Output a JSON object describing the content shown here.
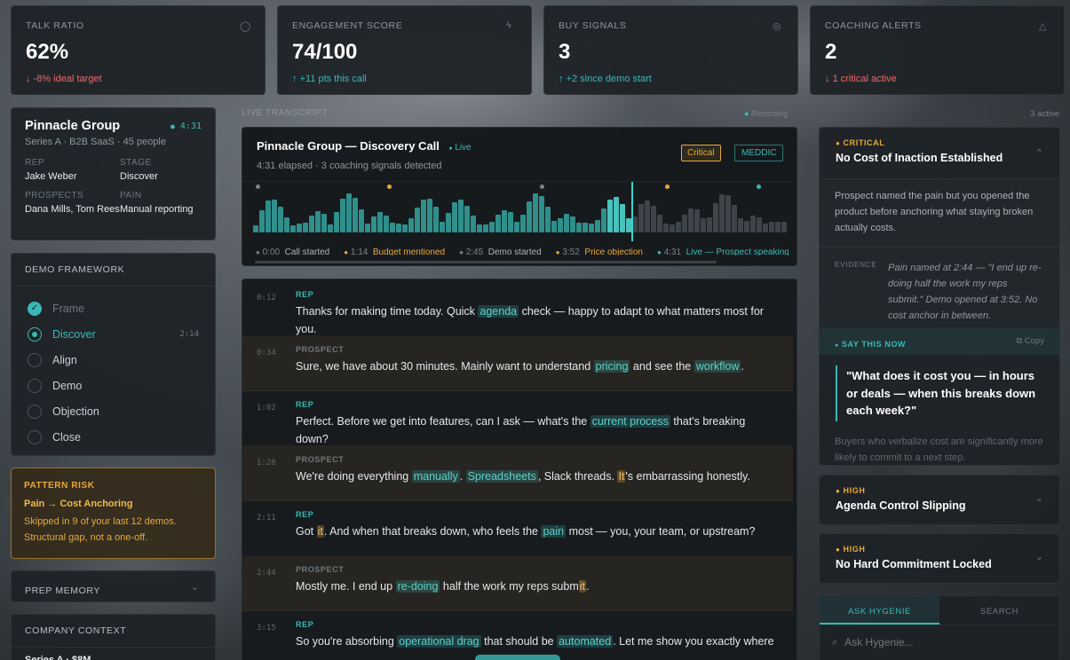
{
  "stats": [
    {
      "label": "Talk Ratio",
      "value": "62%",
      "delta": "-8% ideal target",
      "arrow": "↓",
      "tone": "red",
      "icon": "chat-icon"
    },
    {
      "label": "Engagement Score",
      "value": "74/100",
      "delta": "+11 pts this call",
      "arrow": "↑",
      "tone": "teal",
      "icon": "bolt-icon"
    },
    {
      "label": "Buy Signals",
      "value": "3",
      "delta": "+2 since demo start",
      "arrow": "↑",
      "tone": "teal",
      "icon": "check-circle-icon"
    },
    {
      "label": "Coaching Alerts",
      "value": "2",
      "delta": "1 critical active",
      "arrow": "↓",
      "tone": "red",
      "icon": "warning-icon"
    }
  ],
  "account": {
    "name": "Pinnacle Group",
    "timer": "4:31",
    "meta": "Series A · B2B SaaS · 45 people",
    "rep_label": "Rep",
    "rep": "Jake Weber",
    "stage_label": "Stage",
    "stage": "Discover",
    "prospects_label": "Prospects",
    "prospects": "Dana Mills, Tom Rees",
    "pain_label": "Pain",
    "pain": "Manual reporting"
  },
  "framework": {
    "title": "Demo Framework",
    "steps": [
      {
        "label": "Frame",
        "state": "done"
      },
      {
        "label": "Discover",
        "state": "active",
        "time": "2:14"
      },
      {
        "label": "Align",
        "state": "todo"
      },
      {
        "label": "Demo",
        "state": "todo"
      },
      {
        "label": "Objection",
        "state": "todo"
      },
      {
        "label": "Close",
        "state": "todo"
      }
    ]
  },
  "pattern": {
    "title": "Pattern Risk",
    "headline": "Pain → Cost Anchoring",
    "body": "Skipped in 9 of your last 12 demos. Structural gap, not a one-off."
  },
  "prep_memory": "Prep Memory",
  "company_context": {
    "title": "Company Context",
    "line": "Series A · $8M"
  },
  "transcript": {
    "section_label": "Live Transcript",
    "recording": "Recording",
    "alerts_count": "3 active",
    "call_title": "Pinnacle Group — Discovery Call",
    "live": "Live",
    "subtitle": "4:31 elapsed · 3 coaching signals detected",
    "badge_critical": "Critical",
    "badge_framework": "MEDDIC",
    "markers": [
      {
        "time": "0:00",
        "label": "Call started",
        "tone": "gray"
      },
      {
        "time": "1:14",
        "label": "Budget mentioned",
        "tone": "amber"
      },
      {
        "time": "2:45",
        "label": "Demo started",
        "tone": "gray"
      },
      {
        "time": "3:52",
        "label": "Price objection",
        "tone": "amber"
      },
      {
        "time": "4:31",
        "label": "Live — Prospect speaking",
        "tone": "teal"
      }
    ]
  },
  "messages": [
    {
      "time": "0:12",
      "who": "REP",
      "parts": [
        "Thanks for making time today. Quick ",
        {
          "hl": "agenda"
        },
        " check — happy to adapt to what matters most for you."
      ]
    },
    {
      "time": "0:34",
      "who": "PROSPECT",
      "parts": [
        "Sure, we have about 30 minutes. Mainly want to understand ",
        {
          "hl": "pricing"
        },
        " and see the ",
        {
          "hl": "workflow"
        },
        "."
      ]
    },
    {
      "time": "1:02",
      "who": "REP",
      "parts": [
        "Perfect. Before we get into features, can I ask — what's the ",
        {
          "hl": "current process"
        },
        " that's breaking down?"
      ]
    },
    {
      "time": "1:28",
      "who": "PROSPECT",
      "parts": [
        "We're doing everything ",
        {
          "hl": "manually"
        },
        ". ",
        {
          "hl": "Spreadsheets"
        },
        ", Slack threads. ",
        {
          "hla": "It"
        },
        "'s embarrassing honestly."
      ]
    },
    {
      "time": "2:11",
      "who": "REP",
      "parts": [
        "Got ",
        {
          "hla": "it"
        },
        ". And when that breaks down, who feels the ",
        {
          "hl": "pain"
        },
        " most — you, your team, or upstream?"
      ]
    },
    {
      "time": "2:44",
      "who": "PROSPECT",
      "parts": [
        "Mostly me. I end up ",
        {
          "hl": "re-doing"
        },
        " half the work my reps subm",
        {
          "hla": "it"
        },
        "."
      ]
    },
    {
      "time": "3:15",
      "who": "REP",
      "parts": [
        "So you're absorbing ",
        {
          "hl": "operational drag"
        },
        " that should be ",
        {
          "hl": "automated"
        },
        ". Let me show you exactly where"
      ]
    }
  ],
  "alerts": {
    "critical": {
      "level": "Critical",
      "title": "No Cost of Inaction Established",
      "body": "Prospect named the pain but you opened the product before anchoring what staying broken actually costs.",
      "evidence_label": "Evidence",
      "evidence": "Pain named at 2:44 — \"I end up re-doing half the work my reps submit.\" Demo opened at 3:52. No cost anchor in between.",
      "say_label": "Say This Now",
      "copy": "Copy",
      "quote": "\"What does it cost you — in hours or deals — when this breaks down each week?\"",
      "note": "Buyers who verbalize cost are significantly more likely to commit to a next step."
    },
    "others": [
      {
        "level": "High",
        "title": "Agenda Control Slipping"
      },
      {
        "level": "High",
        "title": "No Hard Commitment Locked"
      }
    ]
  },
  "ask": {
    "tab1": "Ask Hygenie",
    "tab2": "Search",
    "placeholder": "Ask Hygenie..."
  },
  "colors": {
    "teal": "#3bb9b4",
    "amber": "#e8a93c",
    "red": "#ef6a6a"
  }
}
